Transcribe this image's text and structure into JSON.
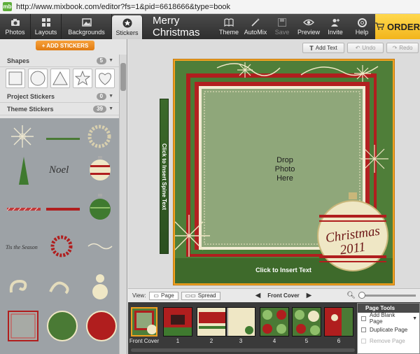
{
  "browser": {
    "url": "http://www.mixbook.com/editor?fs=1&pid=6618666&type=book",
    "favicon_text": "mb"
  },
  "toolbar": {
    "left_tabs": [
      {
        "label": "Photos",
        "icon": "camera-icon"
      },
      {
        "label": "Layouts",
        "icon": "grid-icon"
      },
      {
        "label": "Backgrounds",
        "icon": "image-icon"
      },
      {
        "label": "Stickers",
        "icon": "star-icon",
        "active": true
      }
    ],
    "title": "Merry Christmas",
    "right_tools": [
      {
        "label": "Theme",
        "icon": "book-icon"
      },
      {
        "label": "AutoMix",
        "icon": "wand-icon"
      },
      {
        "label": "Save",
        "icon": "disk-icon",
        "disabled": true
      },
      {
        "label": "Preview",
        "icon": "eye-icon"
      },
      {
        "label": "Invite",
        "icon": "add-person-icon"
      },
      {
        "label": "Help",
        "icon": "lifebuoy-icon"
      }
    ],
    "order_label": "ORDER"
  },
  "panel": {
    "add_stickers_label": "+ ADD STICKERS",
    "sections": [
      {
        "label": "Shapes",
        "count": "5"
      },
      {
        "label": "Project Stickers",
        "count": "0"
      },
      {
        "label": "Theme Stickers",
        "count": "39"
      }
    ],
    "shapes": [
      "square",
      "circle",
      "triangle",
      "star",
      "heart"
    ],
    "sticker_text": {
      "noel": "Noel",
      "tis_the_season": "Tis the Season"
    }
  },
  "editor": {
    "add_text_label": "Add Text",
    "undo_label": "Undo",
    "redo_label": "Redo",
    "spine_label": "Click to Insert Spine Text",
    "photo_placeholder": "Drop Photo Here",
    "cover_text_label": "Click to Insert Text",
    "ornament_line1": "Christmas",
    "ornament_line2": "2011",
    "colors": {
      "green": "#4a7a35",
      "red": "#b01e1e",
      "paper": "#8fa77a",
      "cream": "#efe7c5",
      "accent": "#f0a020"
    }
  },
  "pagebar": {
    "view_label": "View:",
    "page_label": "Page",
    "spread_label": "Spread",
    "current_page": "Front Cover"
  },
  "filmstrip": {
    "thumbs": [
      {
        "label": "Front Cover"
      },
      {
        "label": "1"
      },
      {
        "label": "2"
      },
      {
        "label": "3"
      },
      {
        "label": "4"
      },
      {
        "label": "5"
      },
      {
        "label": "6"
      }
    ]
  },
  "page_tools": {
    "title": "Page Tools",
    "items": [
      {
        "label": "Add Blank Page",
        "disabled": false
      },
      {
        "label": "Duplicate Page",
        "disabled": false
      },
      {
        "label": "Remove Page",
        "disabled": true
      }
    ]
  }
}
